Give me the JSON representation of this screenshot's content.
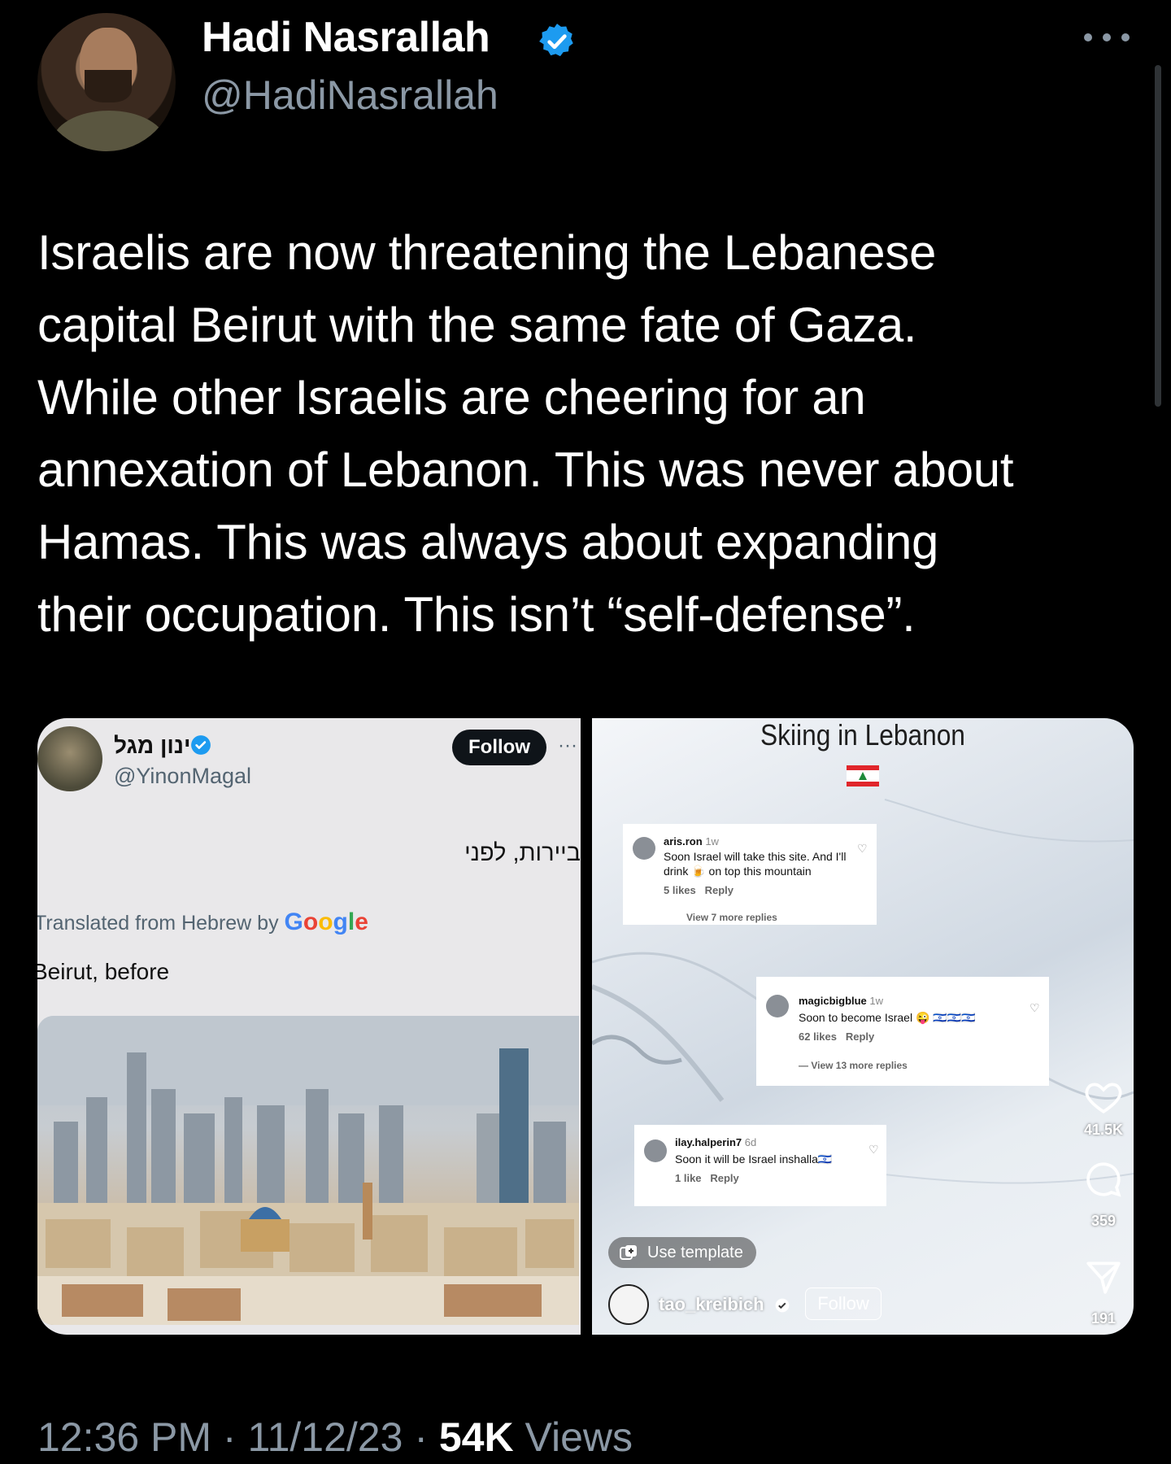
{
  "author": {
    "display_name": "Hadi Nasrallah",
    "handle": "@HadiNasrallah",
    "verified_color": "#1d9bf0"
  },
  "tweet": {
    "text_lines": [
      "Israelis are now threatening the Lebanese",
      "capital Beirut with the same fate of Gaza.",
      "While other Israelis are cheering for an",
      "annexation of Lebanon. This was never about",
      "Hamas. This was always about expanding",
      "their occupation. This isn’t “self-defense”."
    ]
  },
  "media_left": {
    "name": "ינון מגל",
    "handle": "@YinonMagal",
    "follow_label": "Follow",
    "hebrew_text": "ביירות, לפני",
    "translated_prefix": "Translated from Hebrew by",
    "translated_brand": "Google",
    "translated_text": "Beirut, before"
  },
  "media_right": {
    "title": "Skiing in Lebanon",
    "comments": [
      {
        "user": "aris.ron",
        "age": "1w",
        "text_1": "Soon Israel will take this site. And I'll",
        "text_2": "drink 🍺 on top this mountain",
        "likes": "5 likes",
        "reply": "Reply",
        "more": "View 7 more replies"
      },
      {
        "user": "magicbigblue",
        "age": "1w",
        "text_1": "Soon to become Israel 😜 🇮🇱🇮🇱🇮🇱",
        "likes": "62 likes",
        "reply": "Reply",
        "more": "View 13 more replies"
      },
      {
        "user": "ilay.halperin7",
        "age": "6d",
        "text_1": "Soon it will be Israel inshalla🇮🇱",
        "likes": "1 like",
        "reply": "Reply"
      }
    ],
    "likes_count": "41.5K",
    "comments_count": "359",
    "shares_count": "191",
    "use_template_label": "Use template",
    "author": "tao_kreibich",
    "follow_label": "Follow"
  },
  "footer": {
    "time": "12:36 PM",
    "sep1": "·",
    "date": "11/12/23",
    "sep2": "·",
    "views_count": "54K",
    "views_label": "Views"
  }
}
